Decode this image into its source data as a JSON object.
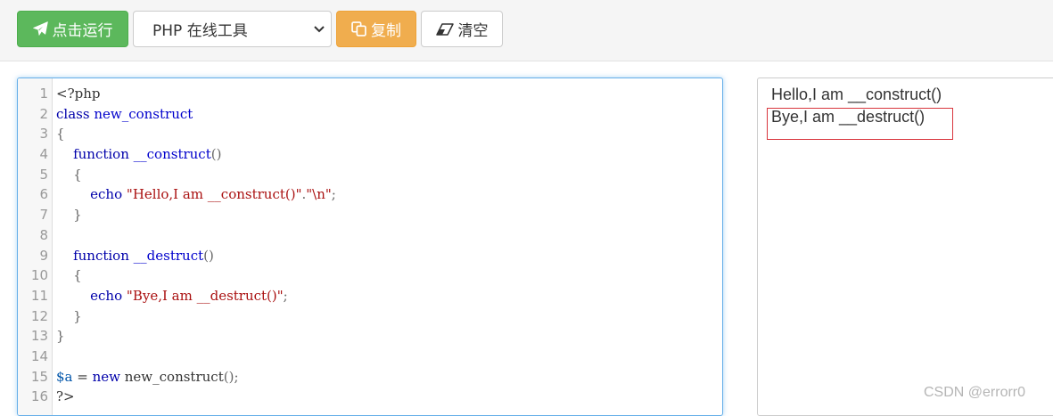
{
  "toolbar": {
    "run_label": "点击运行",
    "language_selected": "PHP 在线工具",
    "copy_label": "复制",
    "clear_label": "清空"
  },
  "editor": {
    "lines": [
      {
        "num": "1",
        "tokens": [
          {
            "t": "plain",
            "v": "<?php"
          }
        ]
      },
      {
        "num": "2",
        "tokens": [
          {
            "t": "kw",
            "v": "class"
          },
          {
            "t": "plain",
            "v": " "
          },
          {
            "t": "def",
            "v": "new_construct"
          }
        ]
      },
      {
        "num": "3",
        "tokens": [
          {
            "t": "punc",
            "v": "{"
          }
        ]
      },
      {
        "num": "4",
        "tokens": [
          {
            "t": "plain",
            "v": "    "
          },
          {
            "t": "kw",
            "v": "function"
          },
          {
            "t": "plain",
            "v": " "
          },
          {
            "t": "def",
            "v": "__construct"
          },
          {
            "t": "punc",
            "v": "()"
          }
        ]
      },
      {
        "num": "5",
        "tokens": [
          {
            "t": "plain",
            "v": "    "
          },
          {
            "t": "punc",
            "v": "{"
          }
        ]
      },
      {
        "num": "6",
        "tokens": [
          {
            "t": "plain",
            "v": "        "
          },
          {
            "t": "kw",
            "v": "echo"
          },
          {
            "t": "plain",
            "v": " "
          },
          {
            "t": "str",
            "v": "\"Hello,I am __construct()\""
          },
          {
            "t": "punc",
            "v": "."
          },
          {
            "t": "str",
            "v": "\"\\n\""
          },
          {
            "t": "punc",
            "v": ";"
          }
        ]
      },
      {
        "num": "7",
        "tokens": [
          {
            "t": "plain",
            "v": "    "
          },
          {
            "t": "punc",
            "v": "}"
          }
        ]
      },
      {
        "num": "8",
        "tokens": []
      },
      {
        "num": "9",
        "tokens": [
          {
            "t": "plain",
            "v": "    "
          },
          {
            "t": "kw",
            "v": "function"
          },
          {
            "t": "plain",
            "v": " "
          },
          {
            "t": "def",
            "v": "__destruct"
          },
          {
            "t": "punc",
            "v": "()"
          }
        ]
      },
      {
        "num": "10",
        "tokens": [
          {
            "t": "plain",
            "v": "    "
          },
          {
            "t": "punc",
            "v": "{"
          }
        ]
      },
      {
        "num": "11",
        "tokens": [
          {
            "t": "plain",
            "v": "        "
          },
          {
            "t": "kw",
            "v": "echo"
          },
          {
            "t": "plain",
            "v": " "
          },
          {
            "t": "str",
            "v": "\"Bye,I am __destruct()\""
          },
          {
            "t": "punc",
            "v": ";"
          }
        ]
      },
      {
        "num": "12",
        "tokens": [
          {
            "t": "plain",
            "v": "    "
          },
          {
            "t": "punc",
            "v": "}"
          }
        ]
      },
      {
        "num": "13",
        "tokens": [
          {
            "t": "punc",
            "v": "}"
          }
        ]
      },
      {
        "num": "14",
        "tokens": []
      },
      {
        "num": "15",
        "tokens": [
          {
            "t": "var",
            "v": "$a"
          },
          {
            "t": "plain",
            "v": " = "
          },
          {
            "t": "kw",
            "v": "new"
          },
          {
            "t": "plain",
            "v": " new_construct"
          },
          {
            "t": "punc",
            "v": "();"
          }
        ]
      },
      {
        "num": "16",
        "tokens": [
          {
            "t": "plain",
            "v": "?>"
          }
        ]
      }
    ]
  },
  "output": {
    "line1": "Hello,I am __construct()",
    "line2": "Bye,I am __destruct()"
  },
  "watermark": "CSDN @errorr0",
  "colors": {
    "run_button": "#5cb85c",
    "copy_button": "#f0ad4e",
    "highlight_border": "#d9363e",
    "editor_focus_border": "#66afe9"
  },
  "icons": {
    "run": "paper-plane-icon",
    "copy": "copy-icon",
    "clear": "eraser-icon",
    "select": "chevron-down-icon"
  }
}
